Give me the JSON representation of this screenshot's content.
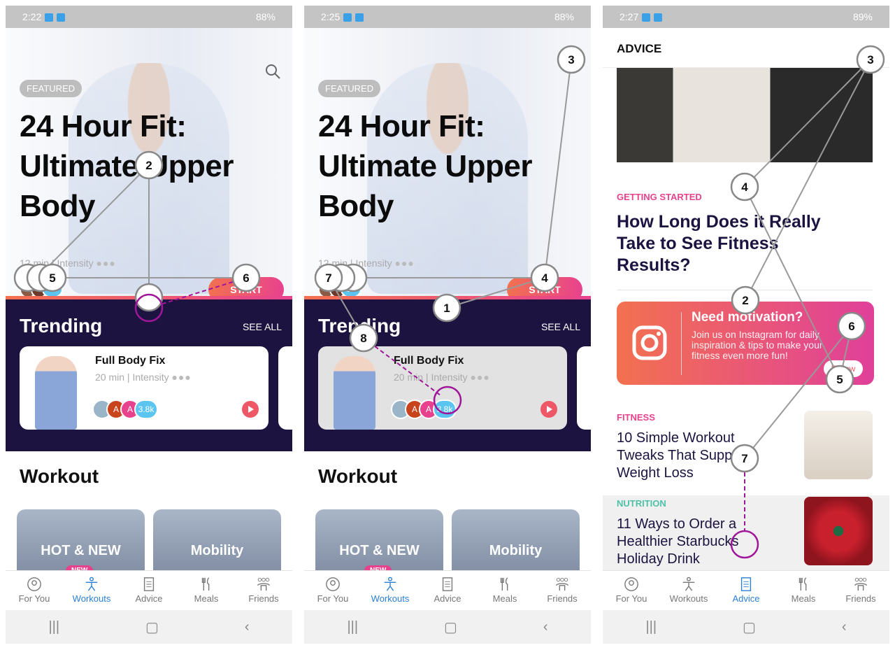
{
  "panels": [
    {
      "status": {
        "time": "2:22",
        "battery": "88%"
      }
    },
    {
      "status": {
        "time": "2:25",
        "battery": "88%"
      }
    },
    {
      "status": {
        "time": "2:27",
        "battery": "89%"
      }
    }
  ],
  "workouts": {
    "featured_badge": "FEATURED",
    "title": "24 Hour Fit: Ultimate Upper Body",
    "duration": "12 min",
    "intensity_label": "Intensity",
    "participants": "1k",
    "start_label": "START",
    "trending": {
      "title": "Trending",
      "see_all": "SEE ALL",
      "card": {
        "name": "Full Body Fix",
        "duration": "20 min",
        "intensity_label": "Intensity",
        "avatar_letters": [
          "A",
          "A"
        ],
        "participants": "3.8k"
      }
    },
    "workout_header": "Workout",
    "categories": [
      {
        "label": "HOT & NEW",
        "badge": "NEW"
      },
      {
        "label": "Mobility"
      }
    ]
  },
  "advice": {
    "header": "ADVICE",
    "featured": {
      "category": "GETTING STARTED",
      "title": "How Long Does it Really Take to See Fitness Results?"
    },
    "instagram": {
      "title": "Need motivation?",
      "text": "Join us on Instagram for daily inspiration & tips to make your fitness even more fun!",
      "button": "Follow"
    },
    "articles": [
      {
        "category": "FITNESS",
        "title": "10 Simple Workout Tweaks That Support Weight Loss"
      },
      {
        "category": "NUTRITION",
        "title": "11 Ways to Order a Healthier Starbucks Holiday Drink"
      }
    ]
  },
  "nav": {
    "items": [
      "For You",
      "Workouts",
      "Advice",
      "Meals",
      "Friends"
    ]
  },
  "colors": {
    "accent": "#2a7fd4",
    "trending_bg": "#1c1340",
    "gradient_start": "#f3714f",
    "gradient_end": "#e8428e",
    "getting_started": "#e8428e",
    "fitness": "#e8428e",
    "nutrition": "#4fc1a8",
    "annotation_highlight": "#a0169a"
  },
  "annotations": {
    "panel1": [
      "2",
      "5",
      "6"
    ],
    "panel2": [
      "3",
      "4",
      "1",
      "7",
      "8"
    ],
    "panel3": [
      "3",
      "4",
      "2",
      "6",
      "5",
      "7"
    ]
  }
}
